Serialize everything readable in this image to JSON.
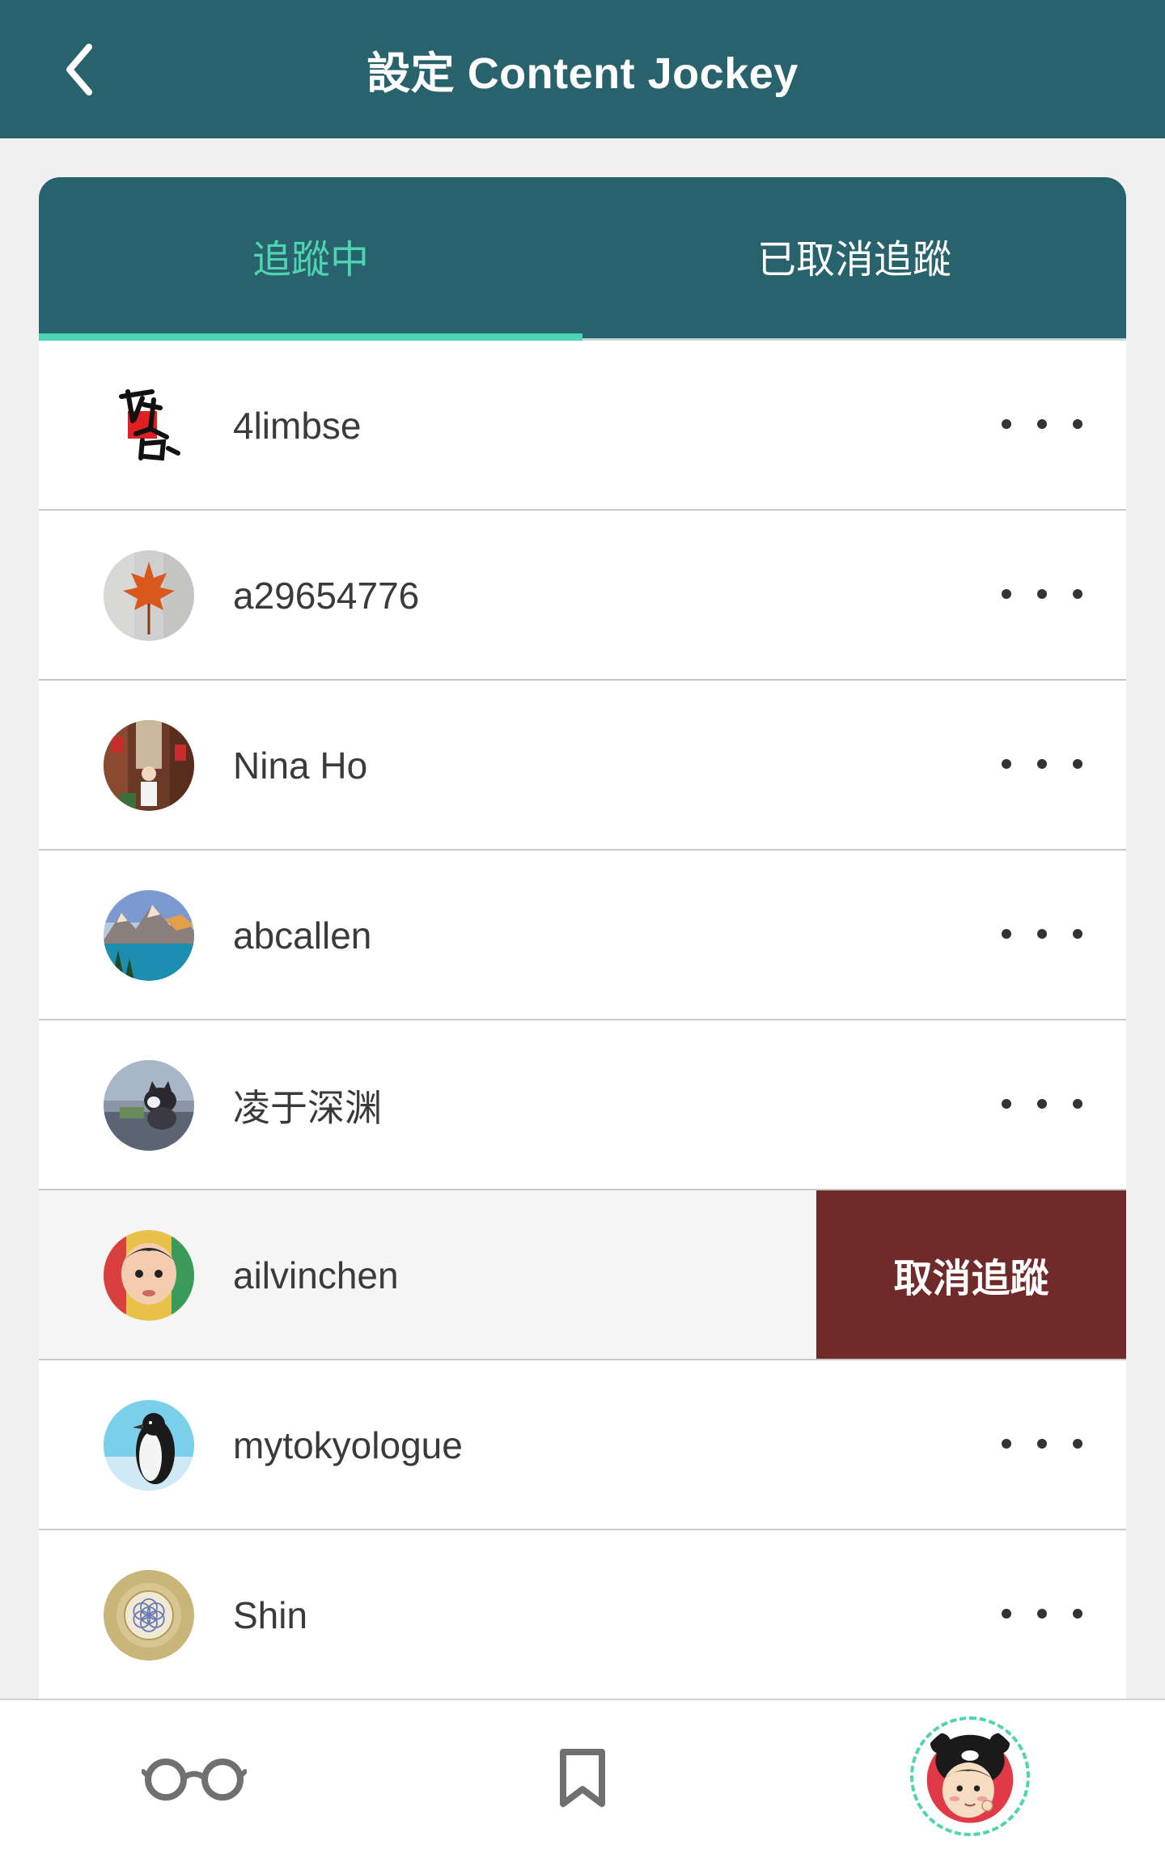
{
  "header": {
    "title": "設定 Content Jockey",
    "back_icon": "chevron-left-icon"
  },
  "tabs": [
    {
      "label": "追蹤中",
      "active": true
    },
    {
      "label": "已取消追蹤",
      "active": false
    }
  ],
  "accent_color": "#4fd3b0",
  "header_color": "#28636d",
  "users": [
    {
      "name": "4limbse",
      "avatar": "calligraphy-avatar"
    },
    {
      "name": "a29654776",
      "avatar": "maple-leaf-avatar"
    },
    {
      "name": "Nina Ho",
      "avatar": "street-photo-avatar"
    },
    {
      "name": "abcallen",
      "avatar": "mountain-lake-avatar"
    },
    {
      "name": "凌于深渊",
      "avatar": "kitten-avatar"
    },
    {
      "name": "ailvinchen",
      "avatar": "baby-avatar",
      "swiped": true
    },
    {
      "name": "mytokyologue",
      "avatar": "penguin-avatar"
    },
    {
      "name": "Shin",
      "avatar": "flower-of-life-avatar"
    }
  ],
  "swipe_action": {
    "label": "取消追蹤",
    "color": "#712a2a"
  },
  "bottom_nav": {
    "items": [
      {
        "icon": "glasses-icon"
      },
      {
        "icon": "bookmark-icon"
      },
      {
        "icon": "profile-avatar"
      }
    ]
  }
}
